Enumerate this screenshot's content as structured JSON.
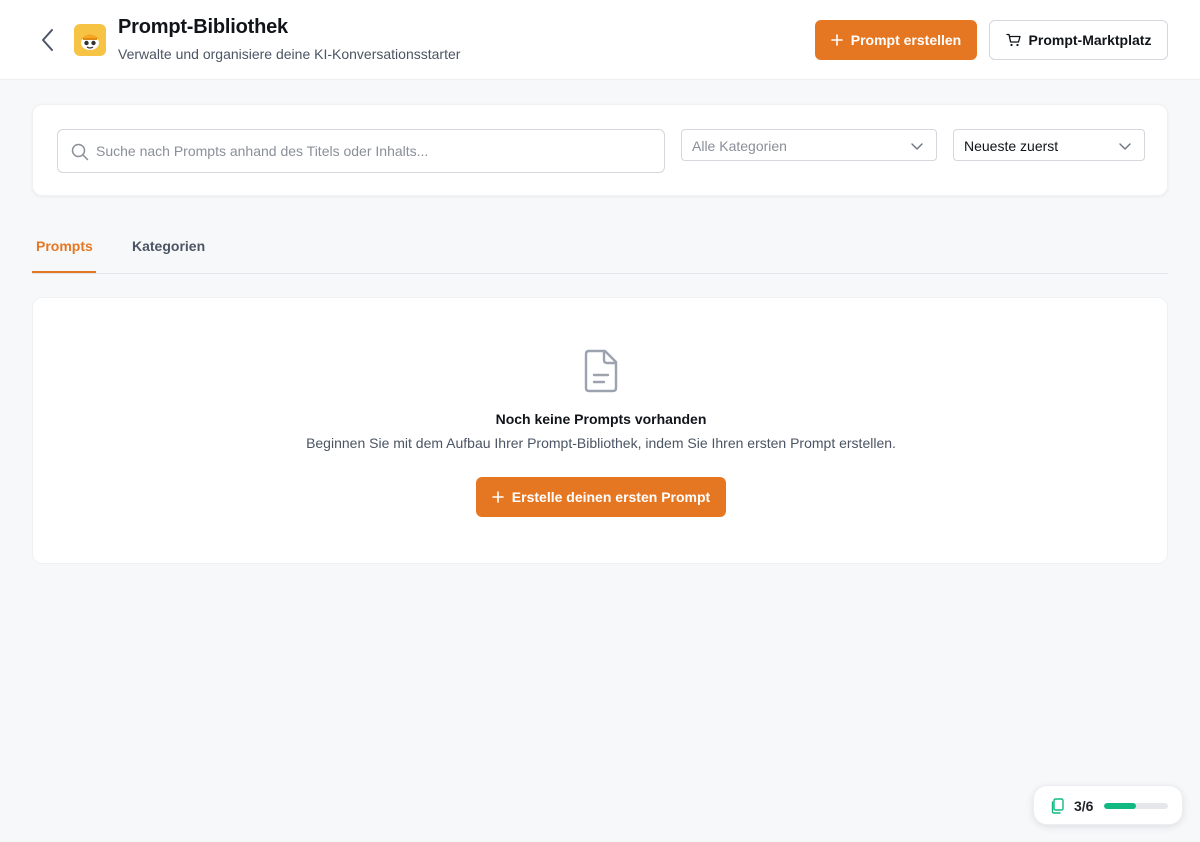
{
  "header": {
    "title": "Prompt-Bibliothek",
    "subtitle": "Verwalte und organisiere deine KI-Konversationsstarter",
    "create_button_label": "Prompt erstellen",
    "marketplace_button_label": "Prompt-Marktplatz"
  },
  "filters": {
    "search_placeholder": "Suche nach Prompts anhand des Titels oder Inhalts...",
    "search_value": "",
    "category_select": "Alle Kategorien",
    "sort_select": "Neueste zuerst"
  },
  "tabs": [
    {
      "label": "Prompts",
      "active": true
    },
    {
      "label": "Kategorien",
      "active": false
    }
  ],
  "empty_state": {
    "title": "Noch keine Prompts vorhanden",
    "description": "Beginnen Sie mit dem Aufbau Ihrer Prompt-Bibliothek, indem Sie Ihren ersten Prompt erstellen.",
    "button_label": "Erstelle deinen ersten Prompt"
  },
  "progress": {
    "label": "3/6",
    "completed": 3,
    "total": 6
  },
  "colors": {
    "accent": "#e67722",
    "progress": "#10b981"
  },
  "icons": [
    "back-arrow-icon",
    "app-logo-icon",
    "plus-icon",
    "cart-icon",
    "search-icon",
    "chevron-down-icon",
    "document-icon",
    "copy-icon"
  ]
}
